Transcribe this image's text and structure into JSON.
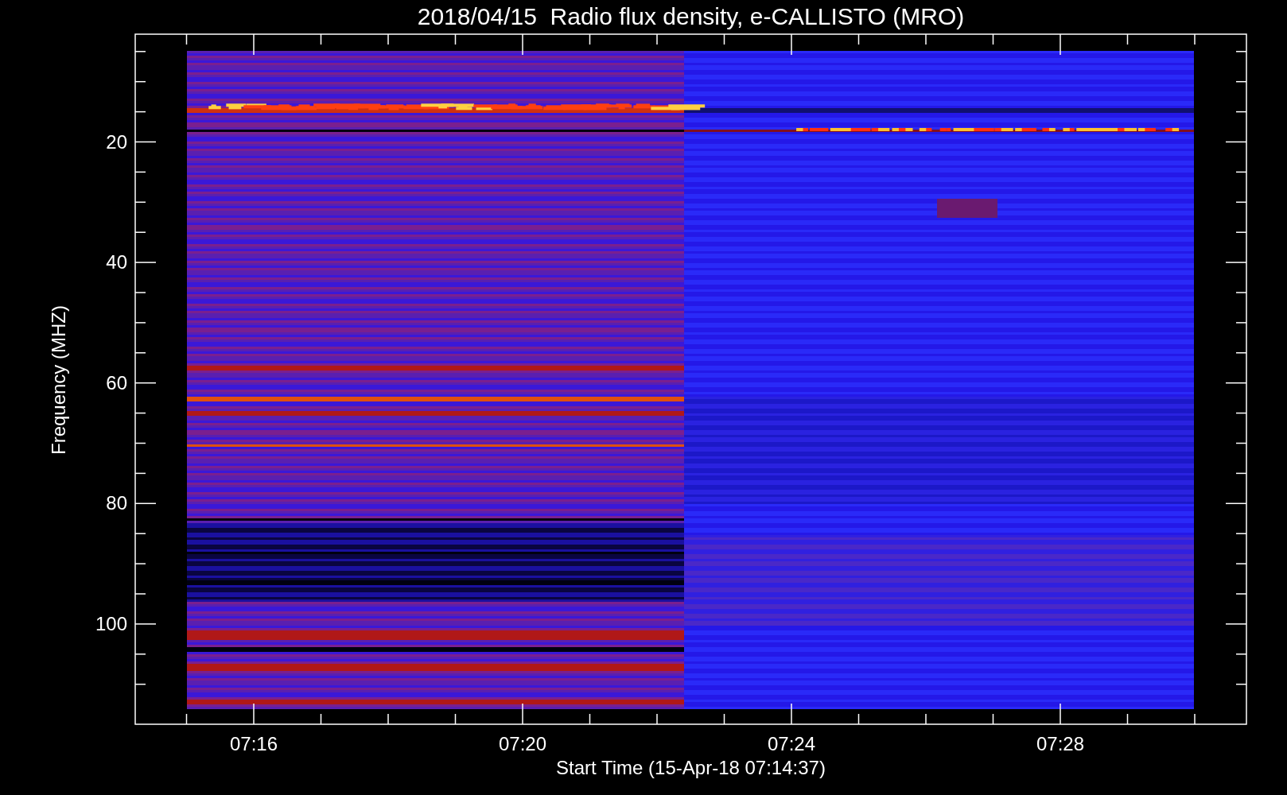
{
  "chart": {
    "title": "2018/04/15  Radio flux density, e-CALLISTO (MRO)",
    "ylabel": "Frequency (MHZ)",
    "xlabel": "Start Time (15-Apr-18 07:14:37)",
    "yticks": [
      "20",
      "40",
      "60",
      "80",
      "100"
    ],
    "xticks": [
      "07:16",
      "07:20",
      "07:24",
      "07:28"
    ]
  }
}
